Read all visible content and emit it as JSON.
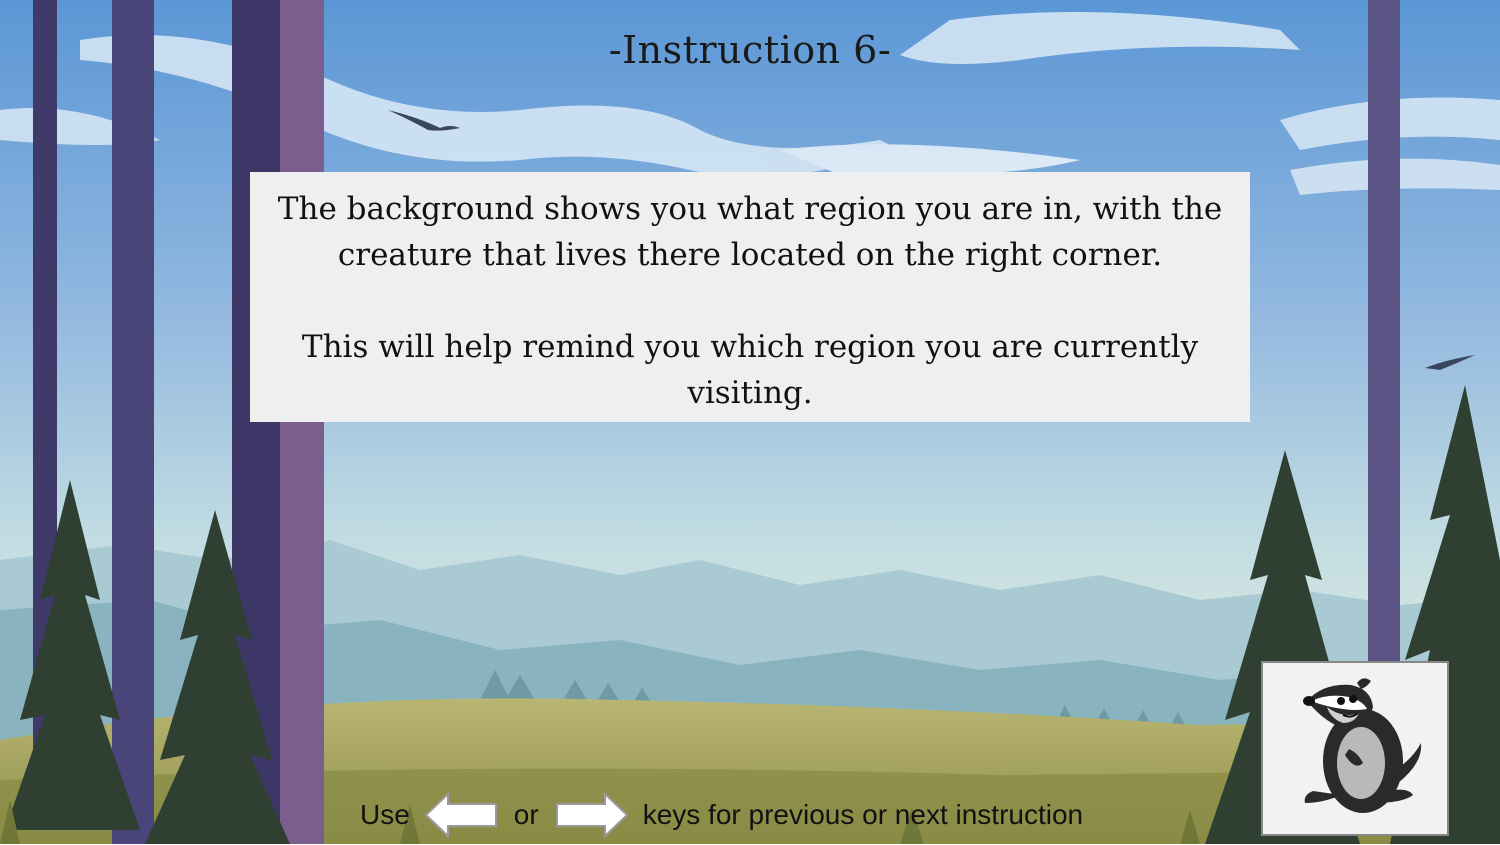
{
  "instruction": {
    "title": "-Instruction 6-",
    "paragraph_1": "The background shows you what region you are in, with the creature that lives there located on the right corner.",
    "paragraph_2": "This will help remind you which region you are currently visiting."
  },
  "navigation": {
    "use_label": "Use",
    "or_label": "or",
    "suffix_label": "keys for previous or next instruction",
    "left_key_icon": "left-arrow-key-icon",
    "right_key_icon": "right-arrow-key-icon"
  },
  "region": {
    "creature_icon": "badger-icon"
  },
  "colors": {
    "sky_top": "#5b97d6",
    "sky_bottom": "#c8e0e4",
    "meadow": "#a6a763",
    "tree_trunk": "#463f73",
    "pine": "#2f4032",
    "panel_bg": "#efefef"
  }
}
